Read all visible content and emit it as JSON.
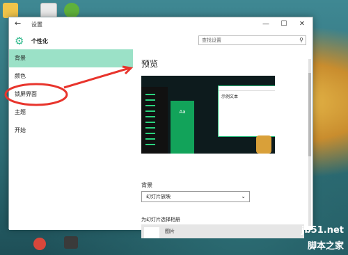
{
  "window": {
    "title": "设置",
    "back_icon": "←",
    "controls": {
      "minimize": "—",
      "maximize": "☐",
      "close": "✕"
    }
  },
  "sidebar": {
    "header_icon": "gear-icon",
    "header_title": "个性化",
    "items": [
      {
        "label": "背景",
        "active": true
      },
      {
        "label": "颜色",
        "active": false
      },
      {
        "label": "锁屏界面",
        "active": false
      },
      {
        "label": "主题",
        "active": false
      },
      {
        "label": "开始",
        "active": false
      }
    ]
  },
  "search": {
    "placeholder": "查找设置",
    "icon": "search-icon"
  },
  "main": {
    "heading": "预览",
    "preview": {
      "tile_text": "Aa",
      "window_text": "示例文本"
    },
    "background_label": "背景",
    "background_select_value": "幻灯片放映",
    "album_label": "为幻灯片选择相册",
    "album_item": "图片"
  },
  "watermark": {
    "top": "jb51.net",
    "bottom": "脚本之家"
  },
  "colors": {
    "accent": "#9be1c7",
    "annotation": "#e8342c"
  }
}
